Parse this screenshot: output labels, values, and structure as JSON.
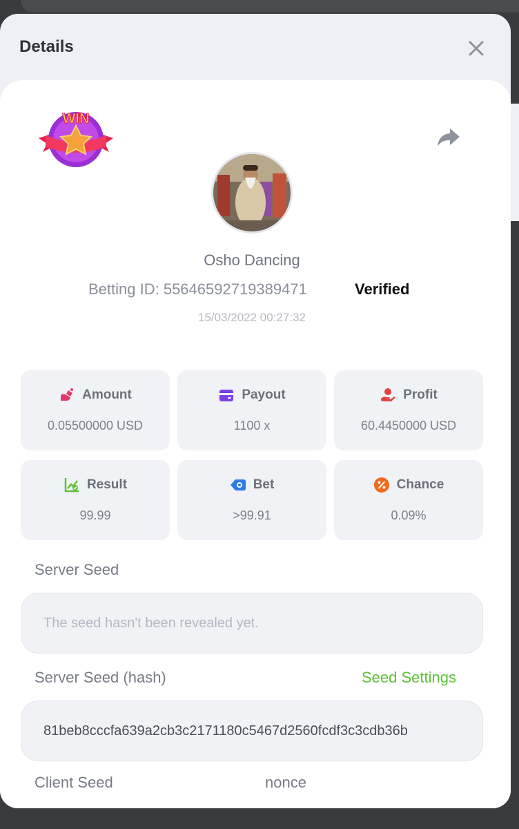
{
  "modal": {
    "title": "Details"
  },
  "header": {
    "badge_text": "WIN",
    "game_name": "Osho Dancing",
    "betting_id": "Betting ID: 55646592719389471",
    "verified": "Verified",
    "timestamp": "15/03/2022 00:27:32"
  },
  "stats": {
    "amount": {
      "label": "Amount",
      "value": "0.05500000 USD"
    },
    "payout": {
      "label": "Payout",
      "value": "1100 x"
    },
    "profit": {
      "label": "Profit",
      "value": "60.4450000 USD"
    },
    "result": {
      "label": "Result",
      "value": "99.99"
    },
    "bet": {
      "label": "Bet",
      "value": ">99.91"
    },
    "chance": {
      "label": "Chance",
      "value": "0.09%"
    }
  },
  "seeds": {
    "server_seed_label": "Server Seed",
    "server_seed_placeholder": "The seed hasn't been revealed yet.",
    "server_seed_hash_label": "Server Seed (hash)",
    "seed_settings_link": "Seed Settings",
    "server_seed_hash_value": "81beb8cccfa639a2cb3c2171180c5467d2560fcdf3c3cdb36b",
    "client_seed_label": "Client Seed",
    "nonce_label": "nonce"
  },
  "colors": {
    "accent_green": "#5bc234",
    "amount_icon": "#e03a6c",
    "payout_icon": "#7b3fe4",
    "profit_icon": "#e0443c",
    "result_icon": "#5bc234",
    "bet_icon": "#2f7be8",
    "chance_icon": "#f06a1d"
  }
}
